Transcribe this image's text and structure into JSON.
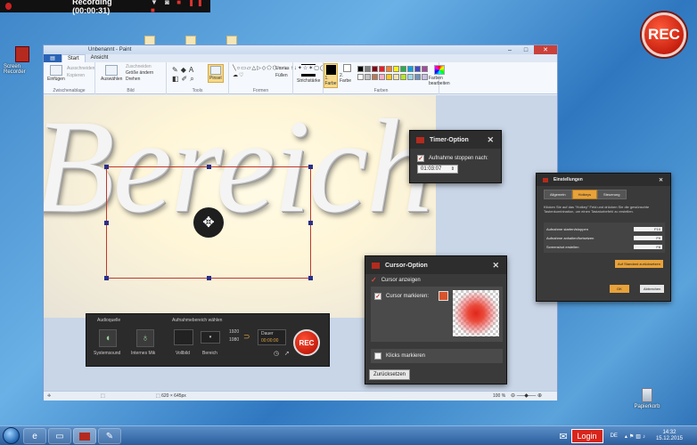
{
  "recording_bar": {
    "title": "Recording (00:00:31)"
  },
  "rec_badge": {
    "label": "REC"
  },
  "desktop": {
    "screen_recorder_label": "Screen Recorder",
    "recycle_bin_label": "Papierkorb"
  },
  "paint": {
    "title": "Unbenannt - Paint",
    "tabs": [
      "Start",
      "Ansicht"
    ],
    "groups": {
      "clipboard": "Zwischenablage",
      "image": "Bild",
      "tools": "Tools",
      "shapes": "Formen",
      "colors": "Farben"
    },
    "buttons": {
      "paste": "Einfügen",
      "cut": "Ausschneiden",
      "copy": "Kopieren",
      "select": "Auswählen",
      "crop": "Zuschneiden",
      "resize": "Größe ändern",
      "rotate": "Drehen",
      "brushes": "Pinsel",
      "outline": "Umriss",
      "fill": "Füllen",
      "size": "Strichstärke",
      "color1": "1. Farbe",
      "color2": "2. Farbe",
      "edit_colors": "Farben bearbeiten"
    },
    "palette": [
      "#000000",
      "#7f7f7f",
      "#880015",
      "#ed1c24",
      "#ff7f27",
      "#fff200",
      "#22b14c",
      "#00a2e8",
      "#3f48cc",
      "#a349a4",
      "#ffffff",
      "#c3c3c3",
      "#b97a57",
      "#ffaec9",
      "#ffc90e",
      "#efe4b0",
      "#b5e61d",
      "#99d9ea",
      "#7092be",
      "#c8bfe7"
    ],
    "canvas_word": "Bereich",
    "status": {
      "dimensions": "620 × 645px",
      "zoom": "100 %"
    }
  },
  "recorder_panel": {
    "audio_label": "Audioquelle",
    "area_label": "Aufnahmebereich wählen",
    "system_sound": "Systemsound",
    "mic": "Internes Mik",
    "fullscreen": "Vollbild",
    "region": "Bereich",
    "width": "1920",
    "height": "1080",
    "duration_label": "Dauer",
    "duration_value": "00:00:00",
    "rec": "REC"
  },
  "timer_dialog": {
    "title": "Timer-Option",
    "stop_label": "Aufnahme stoppen nach:",
    "time": "01:03:07"
  },
  "cursor_dialog": {
    "title": "Cursor-Option",
    "show_cursor": "Cursor anzeigen",
    "mark_cursor": "Cursor markieren:",
    "mark_clicks": "Klicks markieren",
    "reset": "Zurücksetzen",
    "color": "#d9532a"
  },
  "settings_dialog": {
    "title": "Einstellungen",
    "tabs": [
      "Allgemein",
      "Hotkeys",
      "Steuerung"
    ],
    "description": "Klicken Sie auf das \"Hotkey\" Feld und drücken Sie die gewünschte Tastenkombination, um einen Tastaturbefehl zu erstellen.",
    "rows": [
      {
        "label": "Aufnahme starten/stoppen",
        "key": "F10"
      },
      {
        "label": "Aufnahme anhalten/fortsetzen",
        "key": "F9"
      },
      {
        "label": "Screenshot erstellen",
        "key": "F8"
      }
    ],
    "reset_default": "Auf Standard zurücksetzen",
    "ok": "OK",
    "cancel": "Abbrechen"
  },
  "taskbar": {
    "login": "Login",
    "lang": "DE",
    "time": "14:32",
    "date": "15.12.2015"
  }
}
